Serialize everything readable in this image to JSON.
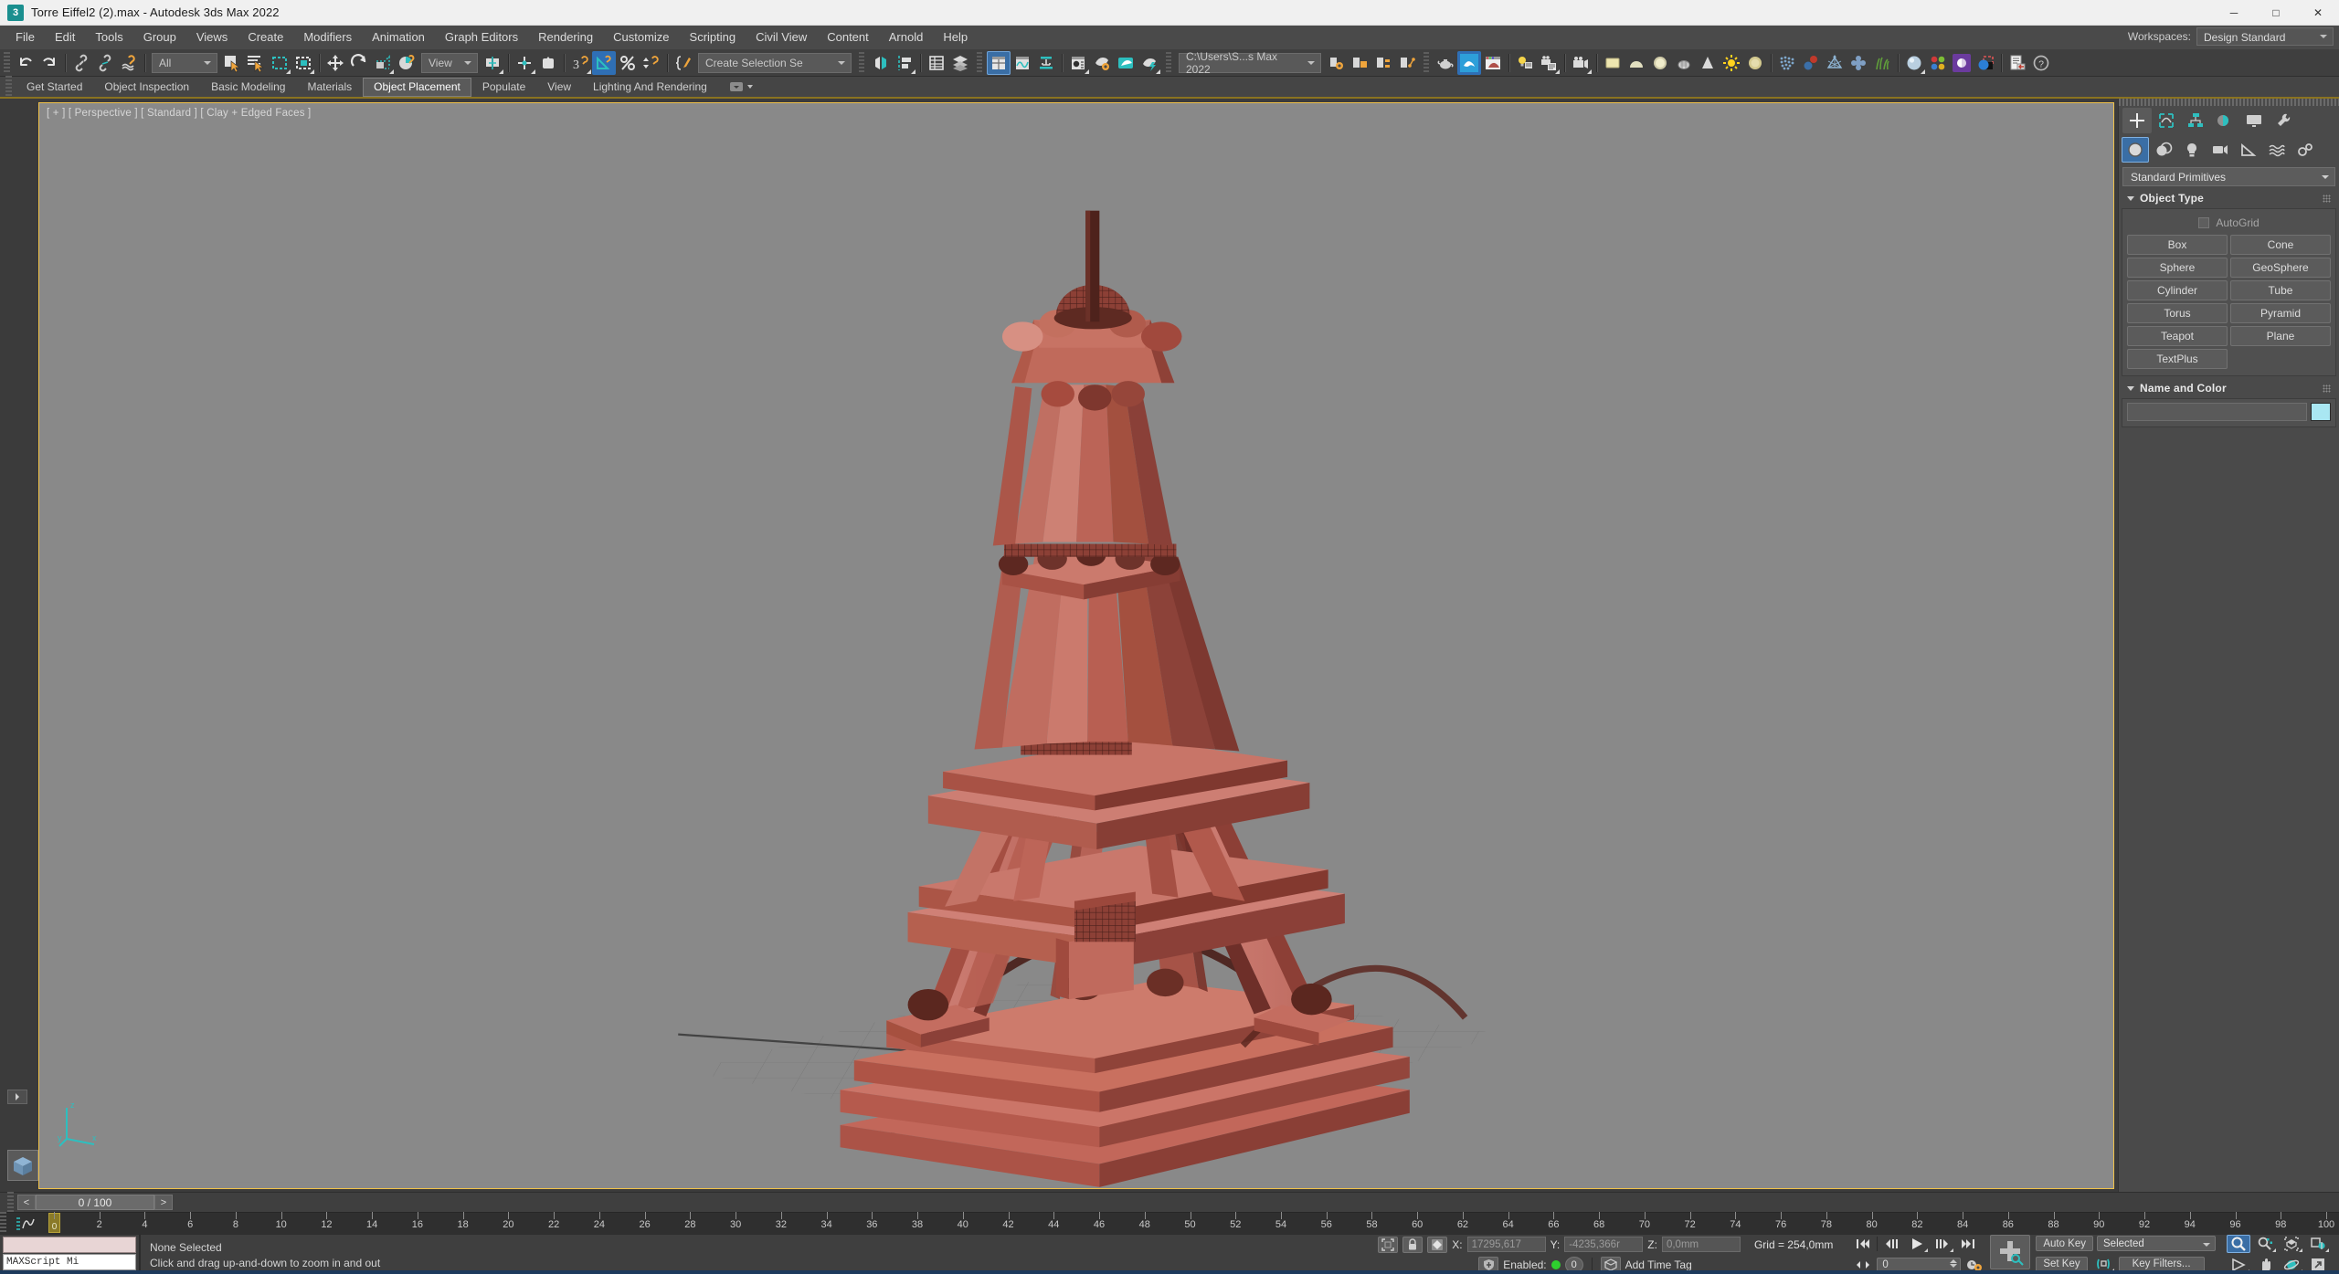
{
  "window": {
    "title": "Torre Eiffel2 (2).max - Autodesk 3ds Max 2022",
    "app_icon": "3",
    "minimize": "─",
    "maximize": "□",
    "close": "✕"
  },
  "menubar": {
    "items": [
      {
        "label": "File"
      },
      {
        "label": "Edit"
      },
      {
        "label": "Tools"
      },
      {
        "label": "Group"
      },
      {
        "label": "Views"
      },
      {
        "label": "Create"
      },
      {
        "label": "Modifiers"
      },
      {
        "label": "Animation"
      },
      {
        "label": "Graph Editors"
      },
      {
        "label": "Rendering"
      },
      {
        "label": "Customize"
      },
      {
        "label": "Scripting"
      },
      {
        "label": "Civil View"
      },
      {
        "label": "Content"
      },
      {
        "label": "Arnold"
      },
      {
        "label": "Help"
      }
    ],
    "workspaces_label": "Workspaces:",
    "workspaces_value": "Design Standard"
  },
  "toolbar": {
    "selection_filter": "All",
    "reference_coord": "View",
    "named_selection_sets": "Create Selection Se",
    "project_folder": "C:\\Users\\S...s Max 2022"
  },
  "ribbon": {
    "tabs": [
      {
        "label": "Get Started",
        "selected": false
      },
      {
        "label": "Object Inspection",
        "selected": false
      },
      {
        "label": "Basic Modeling",
        "selected": false
      },
      {
        "label": "Materials",
        "selected": false
      },
      {
        "label": "Object Placement",
        "selected": true
      },
      {
        "label": "Populate",
        "selected": false
      },
      {
        "label": "View",
        "selected": false
      },
      {
        "label": "Lighting And Rendering",
        "selected": false
      }
    ]
  },
  "viewport": {
    "label": "[ + ] [ Perspective ] [ Standard ] [ Clay + Edged Faces ]",
    "background_color": "#898989",
    "border_color": "#f0c24a",
    "model_name": "Eiffel Tower",
    "model_base_color": "#c05a4e",
    "axis_x": "x",
    "axis_y": "y",
    "axis_z": "z"
  },
  "command_panel": {
    "tabs": [
      {
        "name": "create",
        "selected": true
      },
      {
        "name": "modify",
        "selected": false
      },
      {
        "name": "hierarchy",
        "selected": false
      },
      {
        "name": "motion",
        "selected": false
      },
      {
        "name": "display",
        "selected": false
      },
      {
        "name": "utilities",
        "selected": false
      }
    ],
    "subcategories": [
      {
        "name": "geometry",
        "selected": true
      },
      {
        "name": "shapes",
        "selected": false
      },
      {
        "name": "lights",
        "selected": false
      },
      {
        "name": "cameras",
        "selected": false
      },
      {
        "name": "helpers",
        "selected": false
      },
      {
        "name": "space-warps",
        "selected": false
      },
      {
        "name": "systems",
        "selected": false
      }
    ],
    "category_dropdown": "Standard Primitives",
    "object_type": {
      "title": "Object Type",
      "autogrid_label": "AutoGrid",
      "autogrid_checked": false,
      "buttons": [
        "Box",
        "Cone",
        "Sphere",
        "GeoSphere",
        "Cylinder",
        "Tube",
        "Torus",
        "Pyramid",
        "Teapot",
        "Plane",
        "TextPlus"
      ]
    },
    "name_and_color": {
      "title": "Name and Color",
      "name_value": "",
      "color": "#a9e7f2"
    }
  },
  "time_slider": {
    "prev_label": "<",
    "next_label": ">",
    "current": "0 / 100",
    "frame_start": 0,
    "frame_end": 100,
    "tick_step": 2,
    "playhead_frame": 0,
    "playhead_label": "0"
  },
  "status_bar": {
    "maxscript_minilistener_placeholder": "MAXScript Mi",
    "selection_status": "None Selected",
    "prompt": "Click and drag up-and-down to zoom in and out",
    "coords": {
      "x_label": "X:",
      "x_value": "17295,617",
      "y_label": "Y:",
      "y_value": "-4235,366r",
      "z_label": "Z:",
      "z_value": "0,0mm"
    },
    "grid_text": "Grid = 254,0mm",
    "enabled_label": "Enabled:",
    "enabled_state": "on",
    "key_mode_count": "0",
    "add_time_tag": "Add Time Tag",
    "frame_field": "0",
    "auto_key": "Auto Key",
    "set_key": "Set Key",
    "key_mode_select": "Selected",
    "key_filters": "Key Filters..."
  },
  "colors": {
    "accent_blue": "#3a6ea5",
    "accent_teal": "#2dbfbf",
    "chrome_dark": "#3f3f3f",
    "chrome_mid": "#4a4a4a",
    "viewport_gray": "#898989",
    "highlight_yellow": "#f0c24a",
    "model_red": "#c05a4e"
  }
}
